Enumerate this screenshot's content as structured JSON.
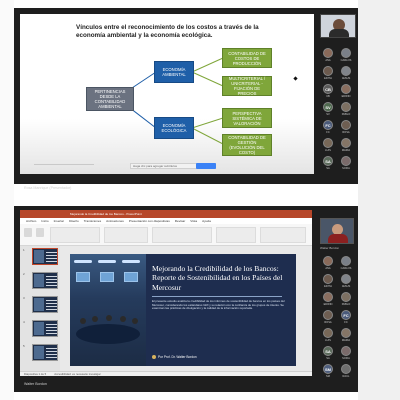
{
  "panel1": {
    "slide": {
      "title": "Vínculos entre el reconocimiento de los costos a través de la economía ambiental y la economía ecológica.",
      "root_box": "PERTINENCIAS DESDE LA CONTABILIDAD AMBIENTAL",
      "mid_top": "ECONOMÍA AMBIENTAL",
      "mid_bottom": "ECONOMÍA ECOLÓGICA",
      "leaf_1": "CONTABILIDAD DE COSTOS DE PRODUCCIÓN",
      "leaf_2": "MULTICRITERIAL / UNICRITERIAL - FIJACIÓN DE PRECIOS",
      "leaf_3": "PERSPECTIVA SISTÉMICA DE VALORACIÓN",
      "leaf_4": "CONTABILIDAD DE GESTIÓN (EVOLUCIÓN DEL COSTO)"
    },
    "presenter_label": "Rosa Manrique (Presentador)",
    "caption_text": "Haga clic para agregar subtítulos"
  },
  "participants_top": [
    {
      "initials": "",
      "name": "ANA",
      "color": "#8a6a5a"
    },
    {
      "initials": "",
      "name": "CARLOS",
      "color": "#7a7f88"
    },
    {
      "initials": "",
      "name": "EDITH",
      "color": "#6c5a4e"
    },
    {
      "initials": "",
      "name": "JESUS",
      "color": "#80848a"
    },
    {
      "initials": "CB",
      "name": "CB",
      "color": "#5a5a5a"
    },
    {
      "initials": "",
      "name": "EDWIN",
      "color": "#8a6e5f"
    },
    {
      "initials": "SV",
      "name": "SV",
      "color": "#4f6a4f"
    },
    {
      "initials": "",
      "name": "PABLO",
      "color": "#7d7062"
    },
    {
      "initials": "FC",
      "name": "FC",
      "color": "#4a5a7a"
    },
    {
      "initials": "",
      "name": "ROSA",
      "color": "#6e5e52"
    },
    {
      "initials": "",
      "name": "LUIS",
      "color": "#786858"
    },
    {
      "initials": "",
      "name": "MARIA",
      "color": "#857566"
    },
    {
      "initials": "SA",
      "name": "SA",
      "color": "#5a6a5a"
    },
    {
      "initials": "",
      "name": "SOFIA",
      "color": "#7a6a6a"
    }
  ],
  "panel2": {
    "window_title": "Mejorando la Credibilidad de los Bancos - PowerPoint",
    "menu": [
      "Archivo",
      "Inicio",
      "Insertar",
      "Diseño",
      "Transiciones",
      "Animaciones",
      "Presentación con diapositivas",
      "Revisar",
      "Vista",
      "Ayuda"
    ],
    "slide": {
      "title": "Mejorando la Credibilidad de los Bancos: Reporte de Sostenibilidad en los Países del Mercosur",
      "body": "El presente estudio analiza la credibilidad de los informes de sostenibilidad de bancos en los países del Mercosur, considerando los estándares GRI y su relación con la confianza de los grupos de interés. Se examinan las prácticas de divulgación y la calidad de la información reportada.",
      "author": "Por Prof. Dr. Walter Bordon"
    },
    "status": [
      "Diapositiva 1 de 5",
      "Accesibilidad: es necesario investigar"
    ],
    "presenter_label": "Walter Bordon",
    "camera_name": "Walter Bordon"
  },
  "participants_bottom": [
    {
      "initials": "",
      "name": "ANA",
      "color": "#8a6a5a"
    },
    {
      "initials": "",
      "name": "CARLOS",
      "color": "#7a7f88"
    },
    {
      "initials": "",
      "name": "EDITH",
      "color": "#6c5a4e"
    },
    {
      "initials": "",
      "name": "JESUS",
      "color": "#80848a"
    },
    {
      "initials": "",
      "name": "EDWIN",
      "color": "#8a6e5f"
    },
    {
      "initials": "",
      "name": "PABLO",
      "color": "#7d7062"
    },
    {
      "initials": "",
      "name": "ROSA",
      "color": "#6e5e52"
    },
    {
      "initials": "FC",
      "name": "FC",
      "color": "#4a5a7a"
    },
    {
      "initials": "",
      "name": "LUIS",
      "color": "#786858"
    },
    {
      "initials": "",
      "name": "MARIA",
      "color": "#857566"
    },
    {
      "initials": "SA",
      "name": "SA",
      "color": "#5a6a5a"
    },
    {
      "initials": "",
      "name": "SOFIA",
      "color": "#7a6a6a"
    },
    {
      "initials": "SM",
      "name": "SM",
      "color": "#4f5f7f"
    },
    {
      "initials": "",
      "name": "RAUL",
      "color": "#6f6f6f"
    }
  ]
}
